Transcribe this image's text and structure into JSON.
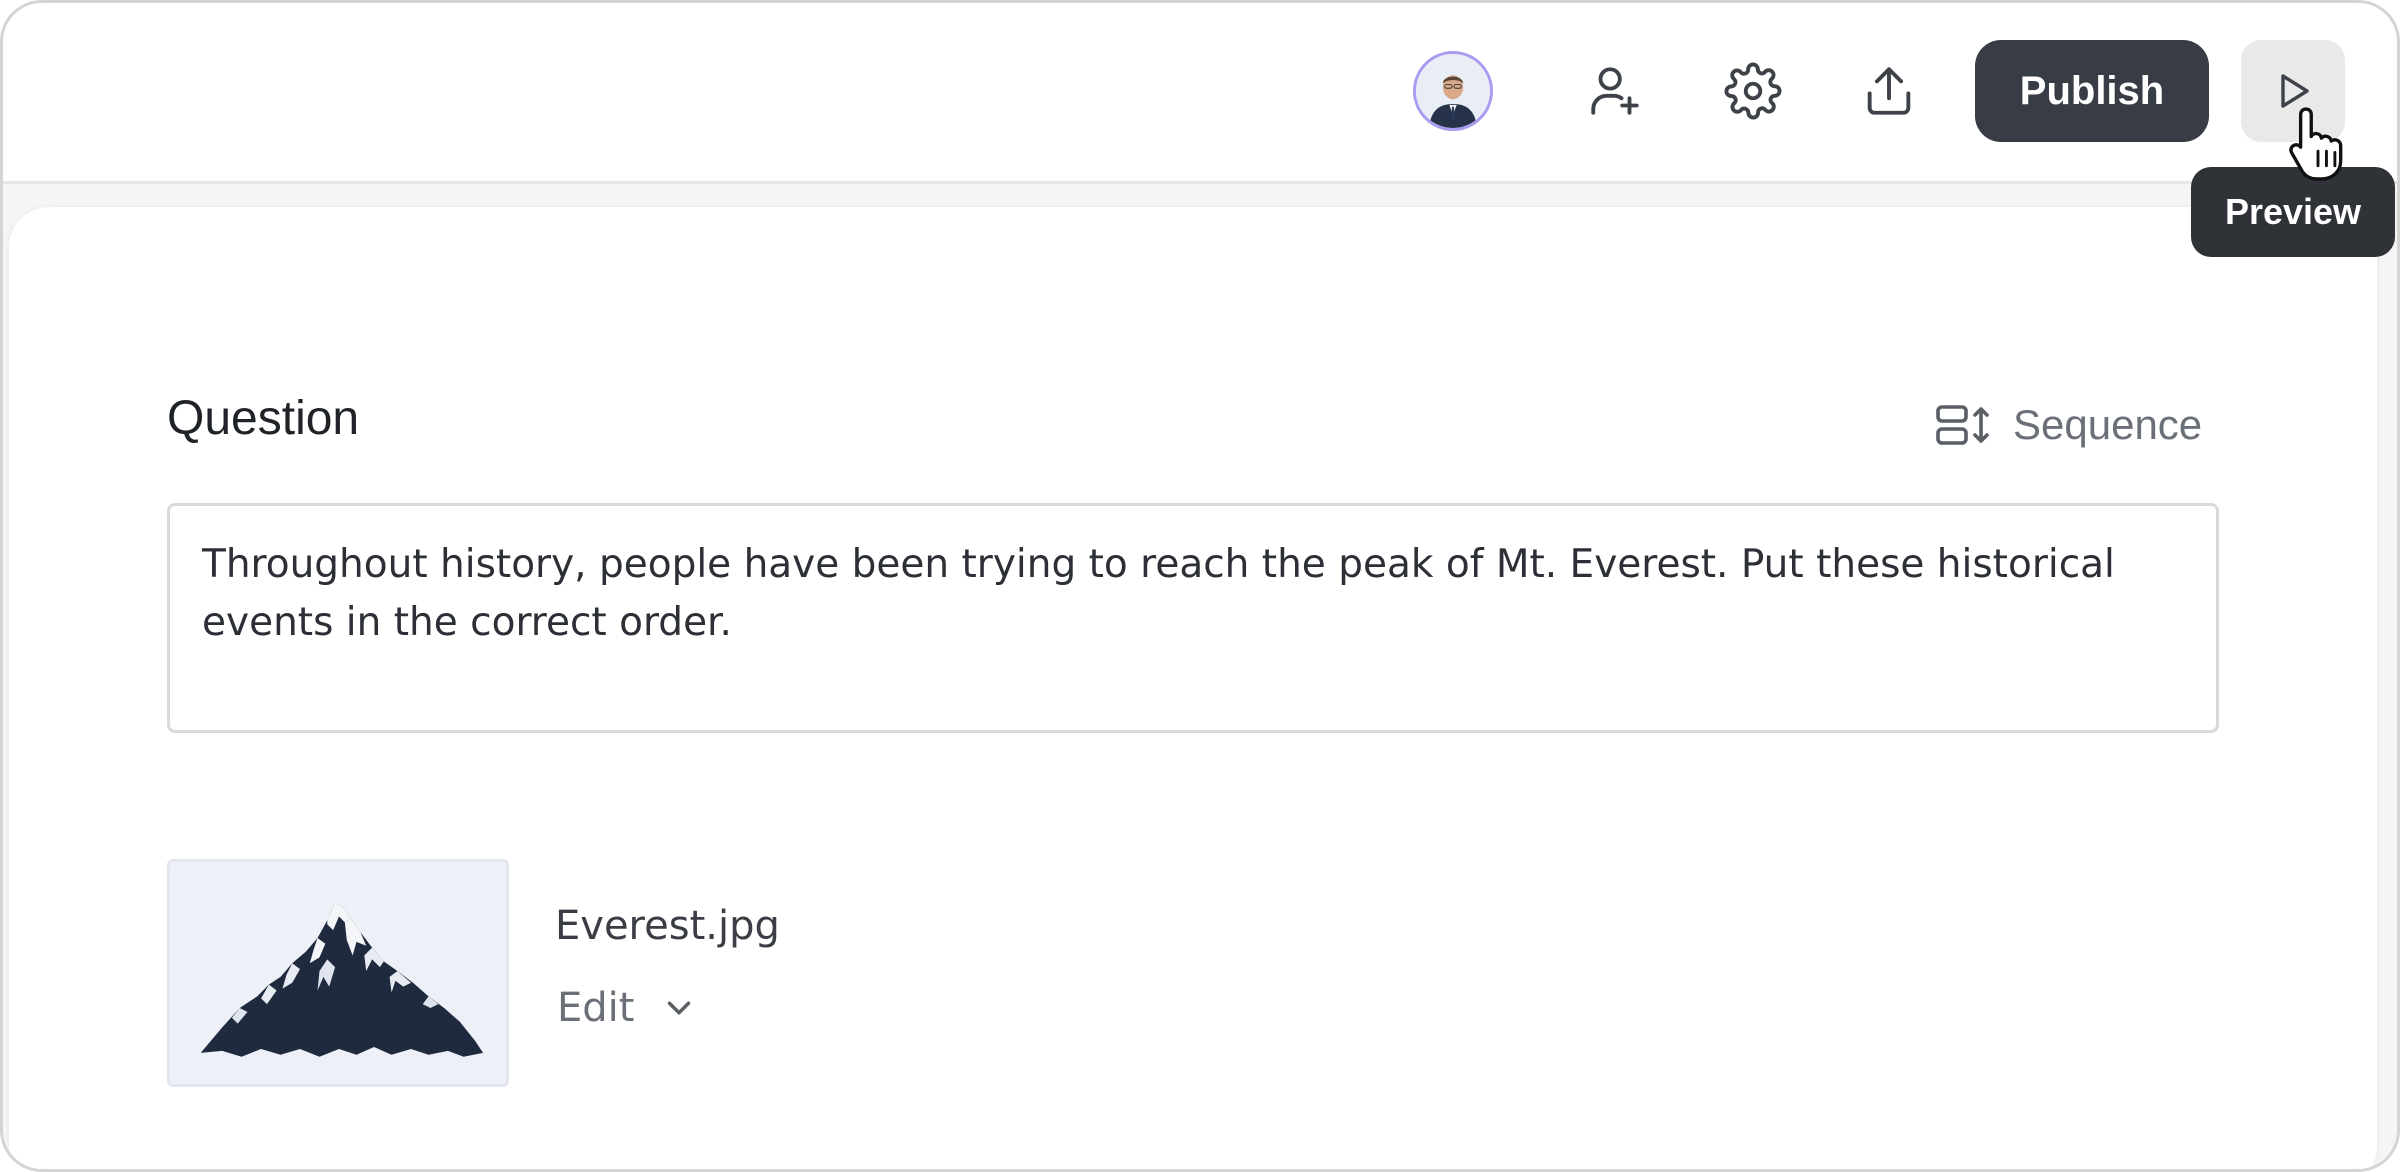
{
  "header": {
    "publish_label": "Publish",
    "tooltip_label": "Preview"
  },
  "icons": {
    "avatar": "user-avatar",
    "add_user": "add-user-icon",
    "settings": "gear-icon",
    "share": "upload-share-icon",
    "preview": "play-icon",
    "sequence": "sequence-icon",
    "chevron": "chevron-down-icon"
  },
  "question": {
    "title": "Question",
    "type_label": "Sequence",
    "text": "Throughout history, people have been trying to reach the peak of Mt. Everest. Put these historical events in the correct order."
  },
  "media": {
    "filename": "Everest.jpg",
    "edit_label": "Edit"
  },
  "colors": {
    "publish_bg": "#383c44",
    "tooltip_bg": "#2f3338",
    "avatar_ring": "#a89cf0",
    "muted_text": "#6b7078"
  }
}
